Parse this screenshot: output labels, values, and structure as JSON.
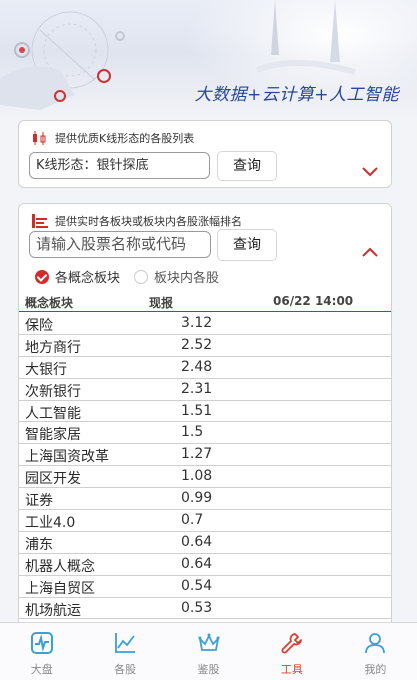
{
  "banner": {
    "slogan": "大数据+云计算+人工智能"
  },
  "kline": {
    "description": "提供优质K线形态的各股列表",
    "input_value": "K线形态：银针探底",
    "query_label": "查询",
    "icon": "candlestick-icon"
  },
  "ranking": {
    "description": "提供实时各板块或板块内各股涨幅排名",
    "input_placeholder": "请输入股票名称或代码",
    "query_label": "查询",
    "icon": "bar-chart-icon",
    "options": [
      {
        "label": "各概念板块",
        "selected": true
      },
      {
        "label": "板块内各股",
        "selected": false
      }
    ],
    "columns": {
      "name": "概念板块",
      "price": "现报",
      "time": "06/22 14:00"
    },
    "rows": [
      {
        "name": "保险",
        "value": "3.12"
      },
      {
        "name": "地方商行",
        "value": "2.52"
      },
      {
        "name": "大银行",
        "value": "2.48"
      },
      {
        "name": "次新银行",
        "value": "2.31"
      },
      {
        "name": "人工智能",
        "value": "1.51"
      },
      {
        "name": "智能家居",
        "value": "1.5"
      },
      {
        "name": "上海国资改革",
        "value": "1.27"
      },
      {
        "name": "园区开发",
        "value": "1.08"
      },
      {
        "name": "证券",
        "value": "0.99"
      },
      {
        "name": "工业4.0",
        "value": "0.7"
      },
      {
        "name": "浦东",
        "value": "0.64"
      },
      {
        "name": "机器人概念",
        "value": "0.64"
      },
      {
        "name": "上海自贸区",
        "value": "0.54"
      },
      {
        "name": "机场航运",
        "value": "0.53"
      }
    ]
  },
  "nav": [
    {
      "label": "大盘",
      "icon": "market-icon",
      "active": false
    },
    {
      "label": "各股",
      "icon": "stocks-icon",
      "active": false
    },
    {
      "label": "鉴股",
      "icon": "crown-icon",
      "active": false
    },
    {
      "label": "工具",
      "icon": "wrench-icon",
      "active": true
    },
    {
      "label": "我的",
      "icon": "user-icon",
      "active": false
    }
  ],
  "colors": {
    "accent": "#d52a2a",
    "nav_icon": "#3aa0d8",
    "slogan": "#27479b"
  }
}
